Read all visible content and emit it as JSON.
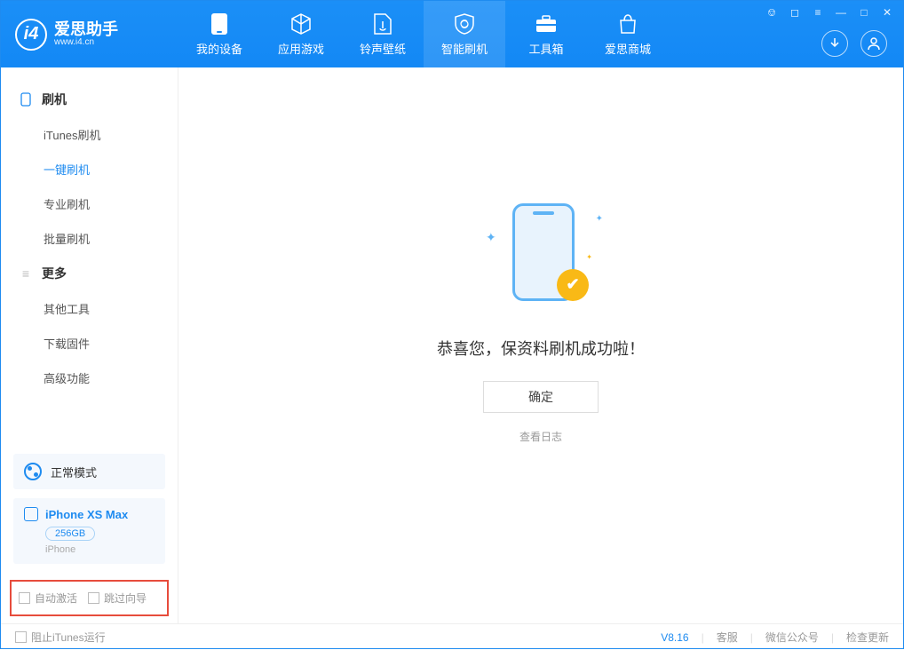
{
  "app": {
    "title": "爱思助手",
    "subtitle": "www.i4.cn"
  },
  "nav": {
    "tabs": [
      {
        "label": "我的设备"
      },
      {
        "label": "应用游戏"
      },
      {
        "label": "铃声壁纸"
      },
      {
        "label": "智能刷机"
      },
      {
        "label": "工具箱"
      },
      {
        "label": "爱思商城"
      }
    ]
  },
  "sidebar": {
    "group1": {
      "title": "刷机",
      "items": [
        "iTunes刷机",
        "一键刷机",
        "专业刷机",
        "批量刷机"
      ]
    },
    "group2": {
      "title": "更多",
      "items": [
        "其他工具",
        "下载固件",
        "高级功能"
      ]
    }
  },
  "mode": {
    "label": "正常模式"
  },
  "device": {
    "name": "iPhone XS Max",
    "capacity": "256GB",
    "type": "iPhone"
  },
  "options": {
    "auto_activate": "自动激活",
    "skip_guide": "跳过向导"
  },
  "main": {
    "success": "恭喜您，保资料刷机成功啦！",
    "ok": "确定",
    "view_log": "查看日志"
  },
  "footer": {
    "block_itunes": "阻止iTunes运行",
    "version": "V8.16",
    "service": "客服",
    "wechat": "微信公众号",
    "update": "检查更新"
  }
}
